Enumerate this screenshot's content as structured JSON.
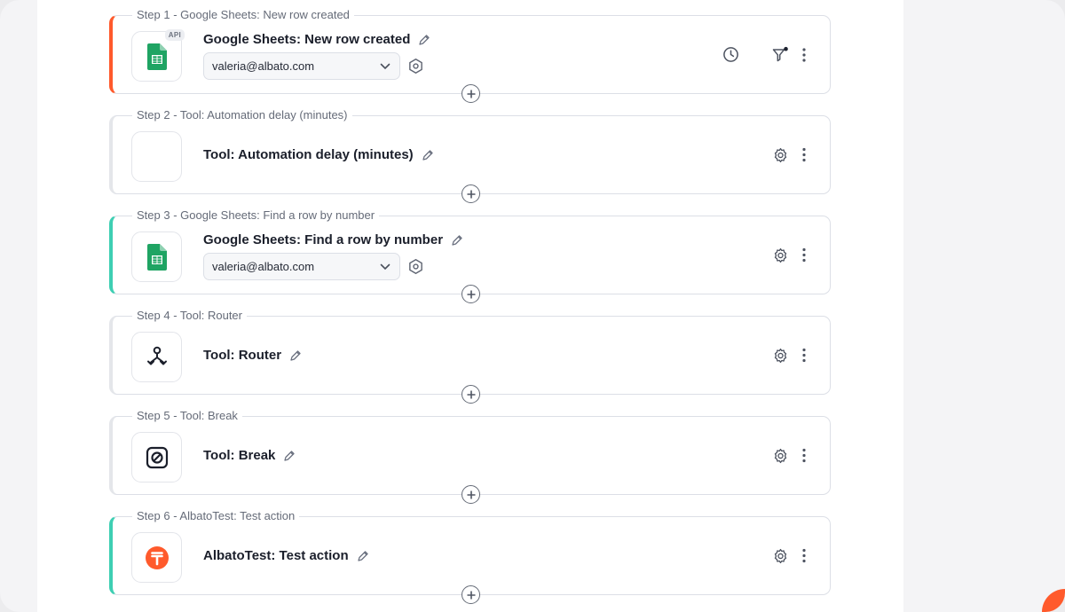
{
  "steps": [
    {
      "label": "Step 1 - Google Sheets: New row created",
      "title": "Google Sheets: New row created",
      "account": "valeria@albato.com",
      "badge": "API"
    },
    {
      "label": "Step 2 - Tool: Automation delay (minutes)",
      "title": "Tool: Automation delay (minutes)"
    },
    {
      "label": "Step 3 - Google Sheets: Find a row by number",
      "title": "Google Sheets: Find a row by number",
      "account": "valeria@albato.com"
    },
    {
      "label": "Step 4 - Tool: Router",
      "title": "Tool: Router"
    },
    {
      "label": "Step 5 - Tool: Break",
      "title": "Tool: Break"
    },
    {
      "label": "Step 6 - AlbatoTest: Test action",
      "title": "AlbatoTest: Test action"
    }
  ],
  "icons": {
    "google_sheets": "google-sheets-icon",
    "router": "router-icon",
    "break": "break-icon",
    "albato": "albato-icon"
  },
  "colors": {
    "accent_orange": "#ff5a2c",
    "accent_teal": "#3ecfb3",
    "sheets_green": "#1fa463"
  }
}
